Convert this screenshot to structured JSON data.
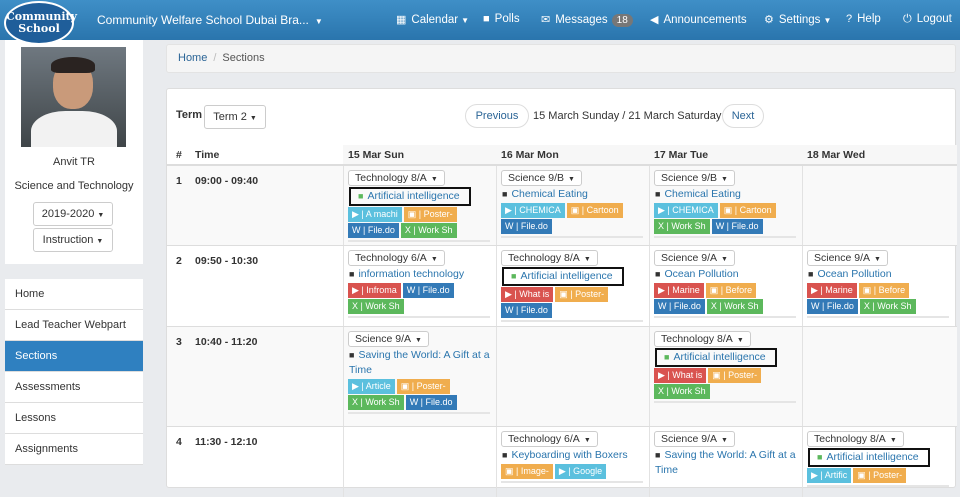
{
  "logo": {
    "line1": "Community",
    "line2": "School"
  },
  "school_name": "Community Welfare School Dubai Bra...",
  "nav": {
    "calendar": "Calendar",
    "polls": "Polls",
    "messages": "Messages",
    "messages_count": "18",
    "announcements": "Announcements",
    "settings": "Settings",
    "help": "Help",
    "logout": "Logout"
  },
  "profile": {
    "name": "Anvit TR",
    "subject": "Science and Technology",
    "year": "2019-2020",
    "role": "Instruction"
  },
  "menu": [
    "Home",
    "Lead Teacher Webpart",
    "Sections",
    "Assessments",
    "Lessons",
    "Assignments"
  ],
  "breadcrumb": {
    "home": "Home",
    "current": "Sections"
  },
  "term": {
    "label": "Term",
    "value": "Term 2"
  },
  "pager": {
    "prev": "Previous",
    "range": "15 March Sunday / 21 March Saturday",
    "next": "Next"
  },
  "headers": {
    "num": "#",
    "time": "Time",
    "days": [
      "15 Mar Sun",
      "16 Mar Mon",
      "17 Mar Tue",
      "18 Mar Wed"
    ]
  },
  "rows": [
    {
      "num": "1",
      "time": "09:00 - 09:40",
      "cells": [
        {
          "class": "Technology 8/A",
          "topic": "Artificial intelligence",
          "hl": true,
          "tags": [
            [
              "blue",
              "▶ | A machi"
            ],
            [
              "orange",
              "▣ | Poster-"
            ],
            [
              "dblue",
              "W | File.do"
            ],
            [
              "green",
              "X | Work Sh"
            ]
          ]
        },
        {
          "class": "Science 9/B",
          "topic": "Chemical Eating",
          "tags": [
            [
              "blue",
              "▶ | CHEMICA"
            ],
            [
              "orange",
              "▣ | Cartoon"
            ],
            [
              "dblue",
              "W | File.do"
            ]
          ]
        },
        {
          "class": "Science 9/B",
          "topic": "Chemical Eating",
          "tags": [
            [
              "blue",
              "▶ | CHEMICA"
            ],
            [
              "orange",
              "▣ | Cartoon"
            ],
            [
              "green",
              "X | Work Sh"
            ],
            [
              "dblue",
              "W | File.do"
            ]
          ]
        },
        null
      ]
    },
    {
      "num": "2",
      "time": "09:50 - 10:30",
      "cells": [
        {
          "class": "Technology 6/A",
          "topic": "information technology",
          "tags": [
            [
              "red",
              "▶ | Infroma"
            ],
            [
              "dblue",
              "W | File.do"
            ],
            [
              "green",
              "X | Work Sh"
            ]
          ]
        },
        {
          "class": "Technology 8/A",
          "topic": "Artificial intelligence",
          "hl": true,
          "tags": [
            [
              "red",
              "▶ | What is"
            ],
            [
              "orange",
              "▣ | Poster-"
            ],
            [
              "dblue",
              "W | File.do"
            ]
          ]
        },
        {
          "class": "Science 9/A",
          "topic": "Ocean Pollution",
          "tags": [
            [
              "red",
              "▶ | Marine"
            ],
            [
              "orange",
              "▣ | Before"
            ],
            [
              "dblue",
              "W | File.do"
            ],
            [
              "green",
              "X | Work Sh"
            ]
          ]
        },
        {
          "class": "Science 9/A",
          "topic": "Ocean Pollution",
          "tags": [
            [
              "red",
              "▶ | Marine"
            ],
            [
              "orange",
              "▣ | Before"
            ],
            [
              "dblue",
              "W | File.do"
            ],
            [
              "green",
              "X | Work Sh"
            ]
          ]
        }
      ]
    },
    {
      "num": "3",
      "time": "10:40 - 11:20",
      "cells": [
        {
          "class": "Science 9/A",
          "topic": "Saving the World: A Gift at a Time",
          "tags": [
            [
              "blue",
              "▶ | Article"
            ],
            [
              "orange",
              "▣ | Poster-"
            ],
            [
              "green",
              "X | Work Sh"
            ],
            [
              "dblue",
              "W | File.do"
            ]
          ]
        },
        null,
        {
          "class": "Technology 8/A",
          "topic": "Artificial intelligence",
          "hl": true,
          "tags": [
            [
              "red",
              "▶ | What is"
            ],
            [
              "orange",
              "▣ | Poster-"
            ],
            [
              "green",
              "X | Work Sh"
            ]
          ]
        },
        null
      ]
    },
    {
      "num": "4",
      "time": "11:30 - 12:10",
      "cells": [
        null,
        {
          "class": "Technology 6/A",
          "topic": "Keyboarding with Boxers",
          "tags": [
            [
              "orange",
              "▣ | Image-"
            ],
            [
              "blue",
              "▶ | Google"
            ]
          ]
        },
        {
          "class": "Science 9/A",
          "topic": "Saving the World: A Gift at a Time",
          "tags": []
        },
        {
          "class": "Technology 8/A",
          "topic": "Artificial intelligence",
          "hl": true,
          "tags": [
            [
              "blue",
              "▶ | Artific"
            ],
            [
              "orange",
              "▣ | Poster-"
            ]
          ]
        }
      ]
    }
  ]
}
